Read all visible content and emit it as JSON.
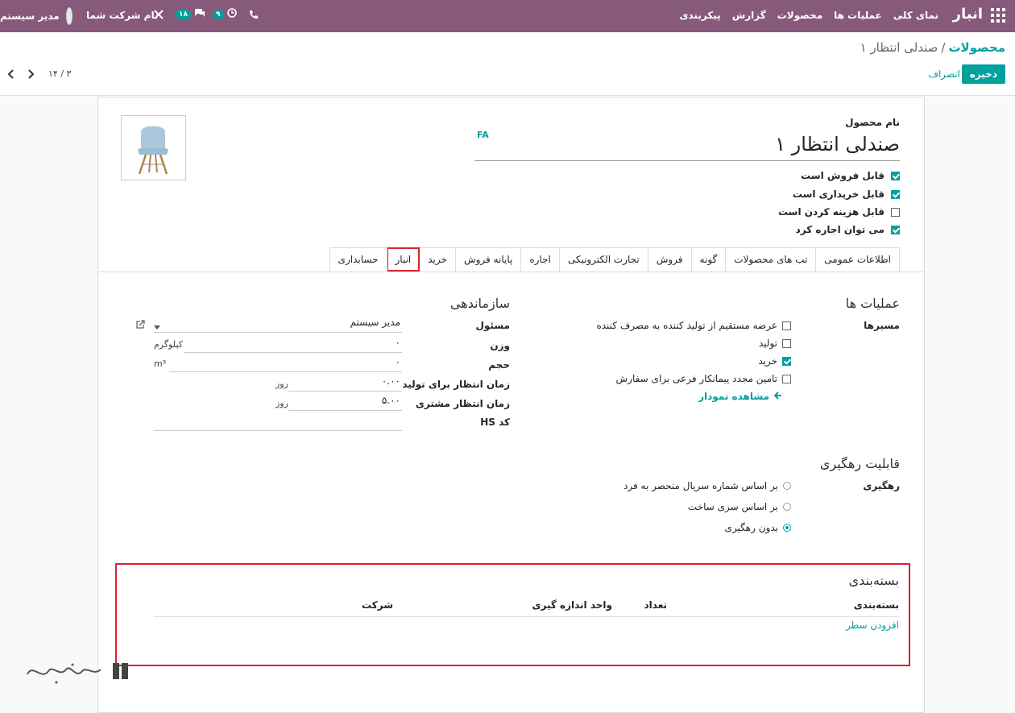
{
  "navbar": {
    "brand": "انبار",
    "menu": [
      "نمای کلی",
      "عملیات ها",
      "محصولات",
      "گزارش",
      "پیکربندی"
    ],
    "user_name": "مدیر سیستم",
    "company_name": "نام شرکت شما",
    "messages_count": "۱۸",
    "activities_count": "۹"
  },
  "control": {
    "breadcrumb_parent": "محصولات",
    "breadcrumb_separator": "/",
    "breadcrumb_current": "صندلی انتظار ۱",
    "save_label": "ذخیره",
    "discard_label": "انصراف",
    "pager": "۱۴ / ۳"
  },
  "product": {
    "name_label": "نام محصول",
    "name": "صندلی انتظار ۱",
    "lang": "FA",
    "checks": [
      {
        "label": "قابل فروش است",
        "checked": true
      },
      {
        "label": "قابل خریداری است",
        "checked": true
      },
      {
        "label": "قابل هزینه کردن است",
        "checked": false
      },
      {
        "label": "می توان اجاره کرد",
        "checked": true
      }
    ]
  },
  "tabs": [
    "اطلاعات عمومی",
    "تب های محصولات",
    "گونه",
    "فروش",
    "تجارت الکترونیکی",
    "اجاره",
    "پایانه فروش",
    "خرید",
    "انبار",
    "حسابداری"
  ],
  "active_tab": "انبار",
  "operations": {
    "title": "عملیات ها",
    "routes_label": "مسیرها",
    "routes": [
      {
        "label": "عرضه مستقیم از تولید کننده به مصرف کننده",
        "checked": false
      },
      {
        "label": "تولید",
        "checked": false
      },
      {
        "label": "خرید",
        "checked": true
      },
      {
        "label": "تامین مجدد پیمانکار فرعی برای سفارش",
        "checked": false
      }
    ],
    "diagram_link": "مشاهده نمودار"
  },
  "logistics": {
    "title": "سازماندهی",
    "responsible_label": "مسئول",
    "responsible_value": "مدیر سیستم",
    "weight_label": "وزن",
    "weight_value": "۰",
    "weight_unit": "کیلوگرم",
    "volume_label": "حجم",
    "volume_value": "۰",
    "volume_unit": "m³",
    "mfg_lead_label": "زمان انتظار برای تولید",
    "mfg_lead_value": "۰.۰۰",
    "mfg_lead_unit": "روز",
    "customer_lead_label": "زمان انتظار مشتری",
    "customer_lead_value": "۵.۰۰",
    "customer_lead_unit": "روز",
    "hs_label": "کد HS"
  },
  "traceability": {
    "title": "قابلیت رهگیری",
    "label": "رهگیری",
    "options": [
      {
        "label": "بر اساس شماره سریال منحصر به فرد",
        "selected": false
      },
      {
        "label": "بر اساس سری ساخت",
        "selected": false
      },
      {
        "label": "بدون رهگیری",
        "selected": true
      }
    ]
  },
  "packaging": {
    "title": "بسته‌بندی",
    "columns": [
      "بسته‌بندی",
      "تعداد",
      "واحد اندازه گیری",
      "شرکت"
    ],
    "add_line": "افزودن سطر"
  },
  "colors": {
    "primary": "#875a7b",
    "accent": "#00a09d",
    "highlight": "#d9232e"
  }
}
